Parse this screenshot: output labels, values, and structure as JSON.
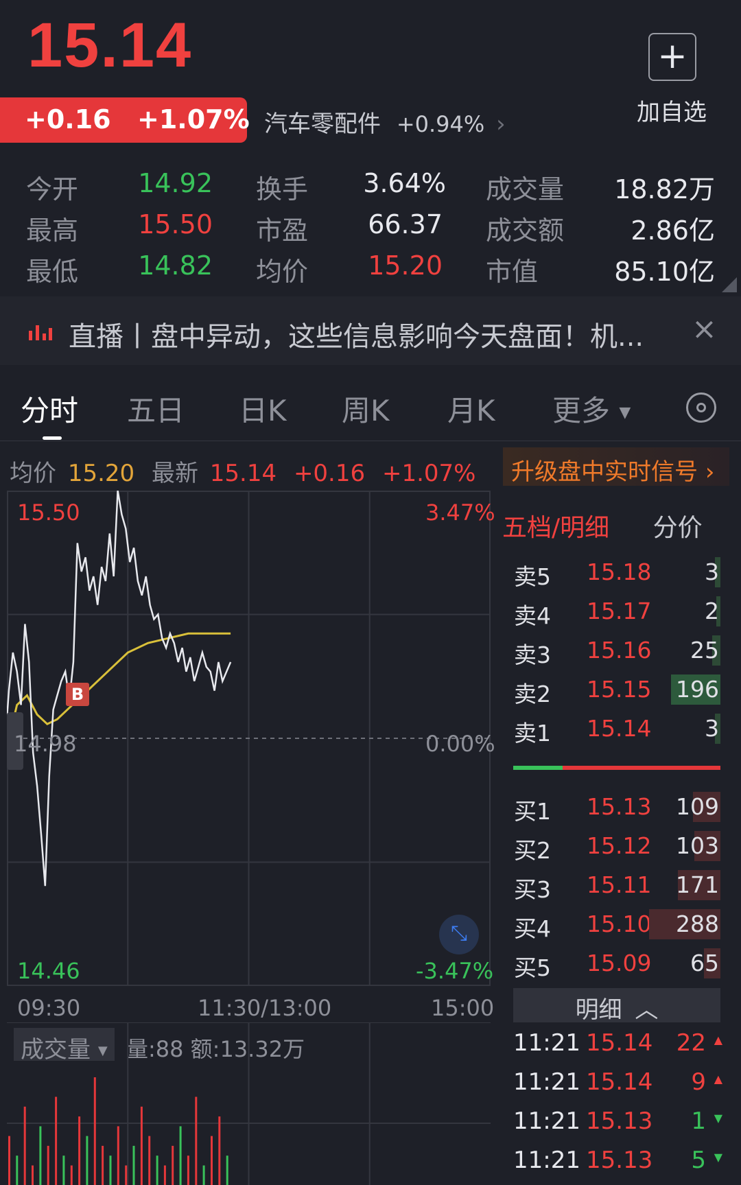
{
  "quote": {
    "price": "15.14",
    "change": "+0.16",
    "change_pct": "+1.07%",
    "sector_name": "汽车零配件",
    "sector_change": "+0.94%",
    "add_watchlist_label": "加自选"
  },
  "stats": {
    "open_label": "今开",
    "open": "14.92",
    "high_label": "最高",
    "high": "15.50",
    "low_label": "最低",
    "low": "14.82",
    "turnover_label": "换手",
    "turnover": "3.64%",
    "pe_label": "市盈",
    "pe": "66.37",
    "avg_label": "均价",
    "avg": "15.20",
    "volume_label": "成交量",
    "volume": "18.82万",
    "amount_label": "成交额",
    "amount": "2.86亿",
    "mcap_label": "市值",
    "mcap": "85.10亿"
  },
  "news": {
    "text": "直播丨盘中异动，这些信息影响今天盘面！机..."
  },
  "tabs": [
    "分时",
    "五日",
    "日K",
    "周K",
    "月K",
    "更多"
  ],
  "chart_header": {
    "avg_label": "均价",
    "avg_value": "15.20",
    "latest_label": "最新",
    "latest_value": "15.14",
    "change": "+0.16",
    "change_pct": "+1.07%",
    "upgrade_label": "升级盘中实时信号"
  },
  "chart_axes": {
    "y_top": "15.50",
    "y_mid": "14.98",
    "y_bottom": "14.46",
    "pct_top": "3.47%",
    "pct_mid": "0.00%",
    "pct_bottom": "-3.47%",
    "t_start": "09:30",
    "t_mid": "11:30/13:00",
    "t_end": "15:00",
    "buy_marker": "B"
  },
  "volume_header": {
    "select_label": "成交量",
    "info": "量:88 额:13.32万"
  },
  "orderbook": {
    "tab_active": "五档/明细",
    "tab_other": "分价",
    "asks": [
      {
        "label": "卖5",
        "price": "15.18",
        "volume": "3"
      },
      {
        "label": "卖4",
        "price": "15.17",
        "volume": "2"
      },
      {
        "label": "卖3",
        "price": "15.16",
        "volume": "25"
      },
      {
        "label": "卖2",
        "price": "15.15",
        "volume": "196"
      },
      {
        "label": "卖1",
        "price": "15.14",
        "volume": "3"
      }
    ],
    "bids": [
      {
        "label": "买1",
        "price": "15.13",
        "volume": "109"
      },
      {
        "label": "买2",
        "price": "15.12",
        "volume": "103"
      },
      {
        "label": "买3",
        "price": "15.11",
        "volume": "171"
      },
      {
        "label": "买4",
        "price": "15.10",
        "volume": "288"
      },
      {
        "label": "买5",
        "price": "15.09",
        "volume": "65"
      }
    ],
    "detail_label": "明细",
    "ticks": [
      {
        "time": "11:21",
        "price": "15.14",
        "volume": "22",
        "dir": "up"
      },
      {
        "time": "11:21",
        "price": "15.14",
        "volume": "9",
        "dir": "up"
      },
      {
        "time": "11:21",
        "price": "15.13",
        "volume": "1",
        "dir": "down"
      },
      {
        "time": "11:21",
        "price": "15.13",
        "volume": "5",
        "dir": "down"
      }
    ]
  },
  "chart_data": {
    "type": "line",
    "title": "",
    "x_range": [
      "09:30",
      "15:00"
    ],
    "ylim": [
      14.46,
      15.5
    ],
    "reference_price": 14.98,
    "series": [
      {
        "x": [
          "09:30",
          "09:31",
          "09:33",
          "09:35",
          "09:37",
          "09:39",
          "09:41",
          "09:43",
          "09:45",
          "09:47",
          "09:49",
          "09:51",
          "09:53",
          "09:55",
          "09:57",
          "09:59",
          "10:01",
          "10:03",
          "10:05",
          "10:07",
          "10:09",
          "10:11",
          "10:13",
          "10:15",
          "10:17",
          "10:19",
          "10:21",
          "10:23",
          "10:25",
          "10:27",
          "10:29",
          "10:31",
          "10:33",
          "10:35",
          "10:37",
          "10:39",
          "10:41",
          "10:43",
          "10:45",
          "10:47",
          "10:49",
          "10:51",
          "10:53",
          "10:55",
          "10:57",
          "10:59",
          "11:01",
          "11:03",
          "11:05",
          "11:07",
          "11:09",
          "11:11",
          "11:13",
          "11:15",
          "11:17",
          "11:19",
          "11:21"
        ],
        "values": [
          15.02,
          15.08,
          15.16,
          15.12,
          15.05,
          15.22,
          15.14,
          14.95,
          14.88,
          14.78,
          14.67,
          14.9,
          15.04,
          15.07,
          15.1,
          15.12,
          15.06,
          15.14,
          15.39,
          15.33,
          15.36,
          15.29,
          15.32,
          15.26,
          15.34,
          15.31,
          15.41,
          15.32,
          15.5,
          15.45,
          15.42,
          15.35,
          15.38,
          15.31,
          15.28,
          15.32,
          15.26,
          15.23,
          15.24,
          15.19,
          15.17,
          15.2,
          15.18,
          15.14,
          15.17,
          15.12,
          15.15,
          15.1,
          15.13,
          15.16,
          15.13,
          15.12,
          15.08,
          15.14,
          15.1,
          15.12,
          15.14
        ]
      },
      {
        "x": [
          "09:30",
          "09:35",
          "09:40",
          "09:45",
          "09:50",
          "09:55",
          "10:00",
          "10:10",
          "10:20",
          "10:30",
          "10:40",
          "10:50",
          "11:00",
          "11:10",
          "11:21"
        ],
        "values": [
          14.96,
          15.05,
          15.07,
          15.03,
          15.01,
          15.02,
          15.04,
          15.08,
          15.12,
          15.16,
          15.18,
          15.19,
          15.2,
          15.2,
          15.2
        ]
      }
    ],
    "volume": [
      5,
      3,
      8,
      2,
      6,
      4,
      9,
      3,
      2,
      7,
      5,
      11,
      4,
      3,
      6,
      2,
      4,
      8,
      5,
      3,
      2,
      4,
      6,
      3,
      9,
      2,
      5,
      7,
      3
    ]
  }
}
